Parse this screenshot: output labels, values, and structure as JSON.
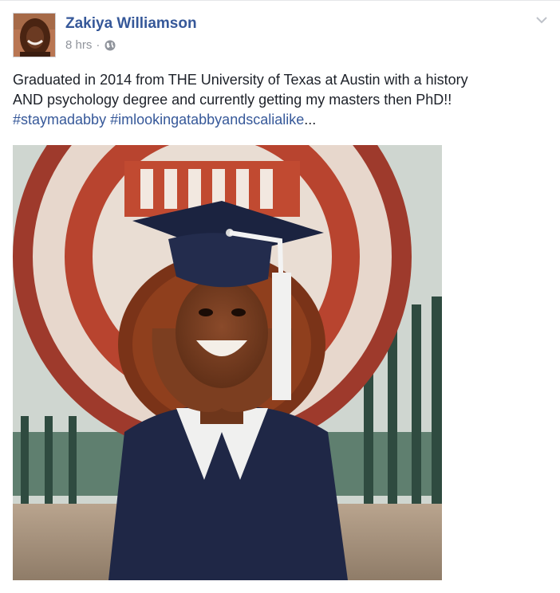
{
  "post": {
    "author": "Zakiya Williamson",
    "time": "8 hrs",
    "separator": "·",
    "privacy_icon": "globe-icon",
    "options_icon": "chevron-down-icon",
    "text_line1": "Graduated in 2014 from THE University of Texas at Austin with a history",
    "text_line2": "AND psychology degree and currently getting my masters then PhD!!",
    "hashtag1": "#staymadabby",
    "hashtag2": "#imlookingatabbyandscalialike",
    "ellipsis": "...",
    "photo_icon": "graduation-photo"
  },
  "colors": {
    "name_link": "#365899",
    "meta_gray": "#90949c",
    "text": "#1d2129",
    "seal_red": "#9e3a2c"
  }
}
